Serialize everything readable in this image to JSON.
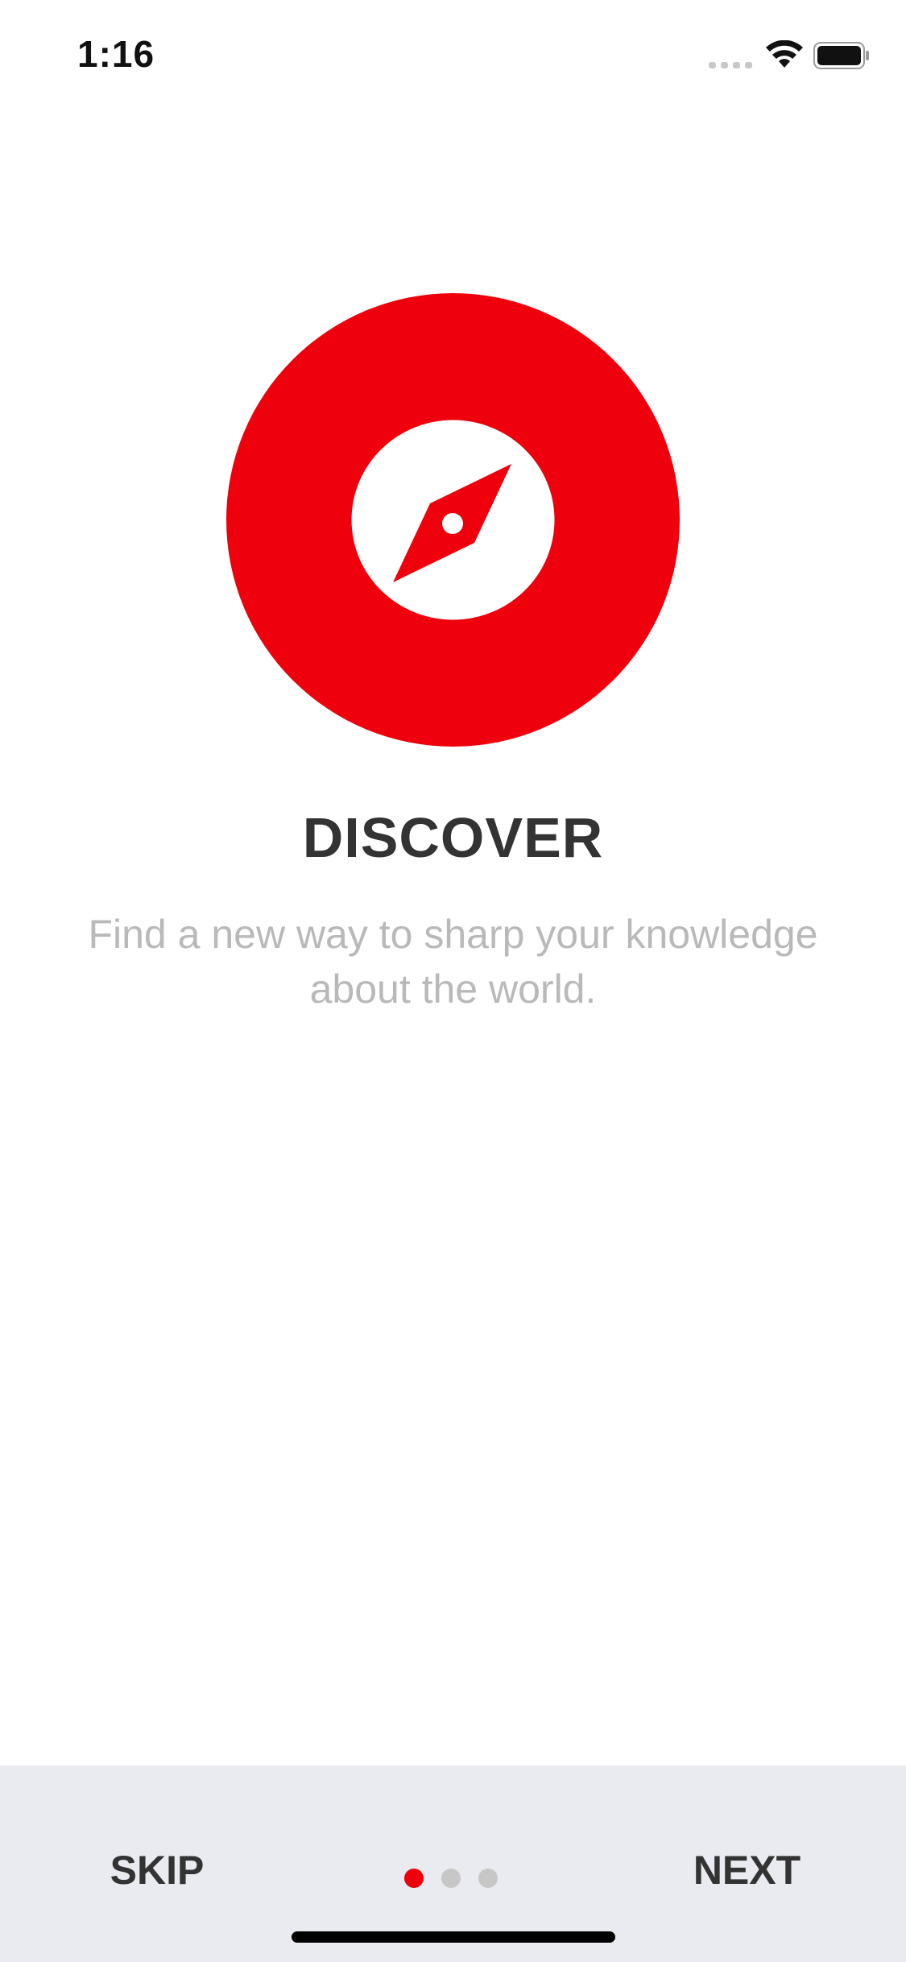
{
  "status_bar": {
    "time": "1:16",
    "signal_icon": "cellular-signal-icon",
    "wifi_icon": "wifi-icon",
    "battery_icon": "battery-icon"
  },
  "hero": {
    "icon": "compass-icon",
    "accent_color": "#ee000c"
  },
  "onboarding": {
    "title": "DISCOVER",
    "subtitle": "Find a new way to sharp your knowledge about the world."
  },
  "footer": {
    "skip_label": "SKIP",
    "next_label": "NEXT",
    "page_indicator": {
      "total": 3,
      "current": 1,
      "active_color": "#ee000c",
      "inactive_color": "#c7c7c7"
    },
    "background_color": "#e9ebf0"
  }
}
